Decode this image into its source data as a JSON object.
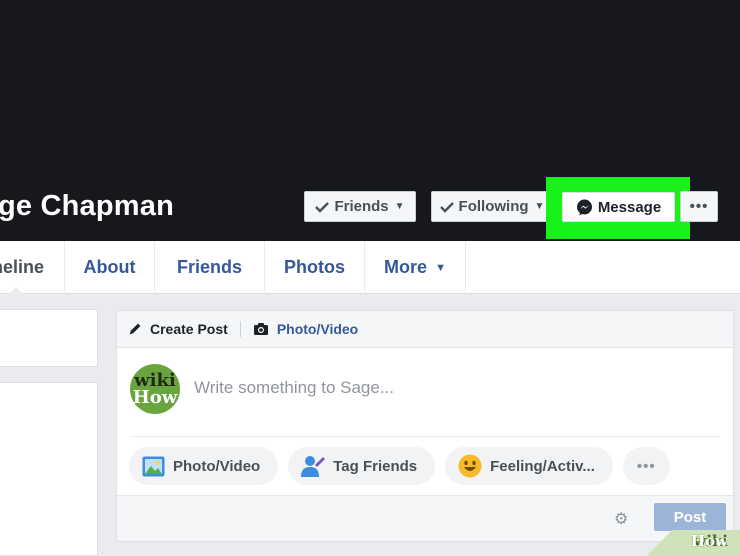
{
  "profile": {
    "name": "ge Chapman"
  },
  "cover_buttons": {
    "friends": "Friends",
    "following": "Following",
    "message": "Message",
    "more": "•••"
  },
  "tabs": [
    {
      "label": "neline"
    },
    {
      "label": "About"
    },
    {
      "label": "Friends"
    },
    {
      "label": "Photos"
    },
    {
      "label": "More"
    }
  ],
  "composer": {
    "create_post": "Create Post",
    "photo_video_head": "Photo/Video",
    "placeholder": "Write something to Sage...",
    "avatar_text_1": "wiki",
    "avatar_text_2": "How",
    "actions": {
      "photo_video": "Photo/Video",
      "tag_friends": "Tag Friends",
      "feeling": "Feeling/Activ...",
      "more": "•••"
    },
    "post_label": "Post"
  },
  "watermark": {
    "part1": "wiki",
    "part2": "How"
  },
  "colors": {
    "highlight": "#19f11b",
    "link": "#365899",
    "cover": "#17181d"
  }
}
